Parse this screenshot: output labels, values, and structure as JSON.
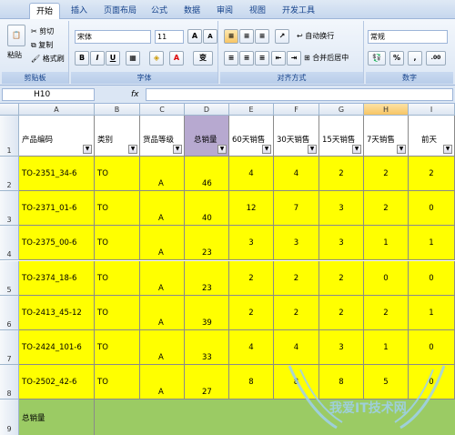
{
  "ribbon_tabs": [
    "开始",
    "插入",
    "页面布局",
    "公式",
    "数据",
    "审阅",
    "视图",
    "开发工具"
  ],
  "clipboard": {
    "paste": "粘贴",
    "cut": "剪切",
    "copy": "复制",
    "format_painter": "格式刷",
    "label": "剪贴板"
  },
  "font": {
    "name": "宋体",
    "size": "11",
    "grow": "A",
    "shrink": "A",
    "bold": "B",
    "italic": "I",
    "underline": "U",
    "label": "字体",
    "phonetic": "变"
  },
  "alignment": {
    "wrap": "自动换行",
    "merge": "合并后居中",
    "label": "对齐方式"
  },
  "number": {
    "format": "常规",
    "percent": "%",
    "comma": ",",
    "label": "数字"
  },
  "formula_bar": {
    "name_box": "H10",
    "fx": "fx",
    "value": ""
  },
  "columns": [
    "A",
    "B",
    "C",
    "D",
    "E",
    "F",
    "G",
    "H",
    "I"
  ],
  "selected_column": "H",
  "headers": [
    "产品编码",
    "类别",
    "货品等级",
    "总销量",
    "60天销售",
    "30天销售",
    "15天销售",
    "7天销售",
    "前天"
  ],
  "rows": [
    {
      "num": "2",
      "code": "TO-2351_34-6",
      "cat": "TO",
      "grade": "A",
      "total": "46",
      "d60": "4",
      "d30": "4",
      "d15": "2",
      "d7": "2",
      "prev": "2"
    },
    {
      "num": "3",
      "code": "TO-2371_01-6",
      "cat": "TO",
      "grade": "A",
      "total": "40",
      "d60": "12",
      "d30": "7",
      "d15": "3",
      "d7": "2",
      "prev": "0"
    },
    {
      "num": "4",
      "code": "TO-2375_00-6",
      "cat": "TO",
      "grade": "A",
      "total": "23",
      "d60": "3",
      "d30": "3",
      "d15": "3",
      "d7": "1",
      "prev": "1"
    },
    {
      "num": "5",
      "code": "TO-2374_18-6",
      "cat": "TO",
      "grade": "A",
      "total": "23",
      "d60": "2",
      "d30": "2",
      "d15": "2",
      "d7": "0",
      "prev": "0"
    },
    {
      "num": "6",
      "code": "TO-2413_45-12",
      "cat": "TO",
      "grade": "A",
      "total": "39",
      "d60": "2",
      "d30": "2",
      "d15": "2",
      "d7": "2",
      "prev": "1"
    },
    {
      "num": "7",
      "code": "TO-2424_101-6",
      "cat": "TO",
      "grade": "A",
      "total": "33",
      "d60": "4",
      "d30": "4",
      "d15": "3",
      "d7": "1",
      "prev": "0"
    },
    {
      "num": "8",
      "code": "TO-2502_42-6",
      "cat": "TO",
      "grade": "A",
      "total": "27",
      "d60": "8",
      "d30": "8",
      "d15": "8",
      "d7": "5",
      "prev": "0"
    }
  ],
  "header_row_num": "1",
  "total_row": {
    "num": "9",
    "label": "总销量"
  },
  "watermark": "我爱IT技术网"
}
